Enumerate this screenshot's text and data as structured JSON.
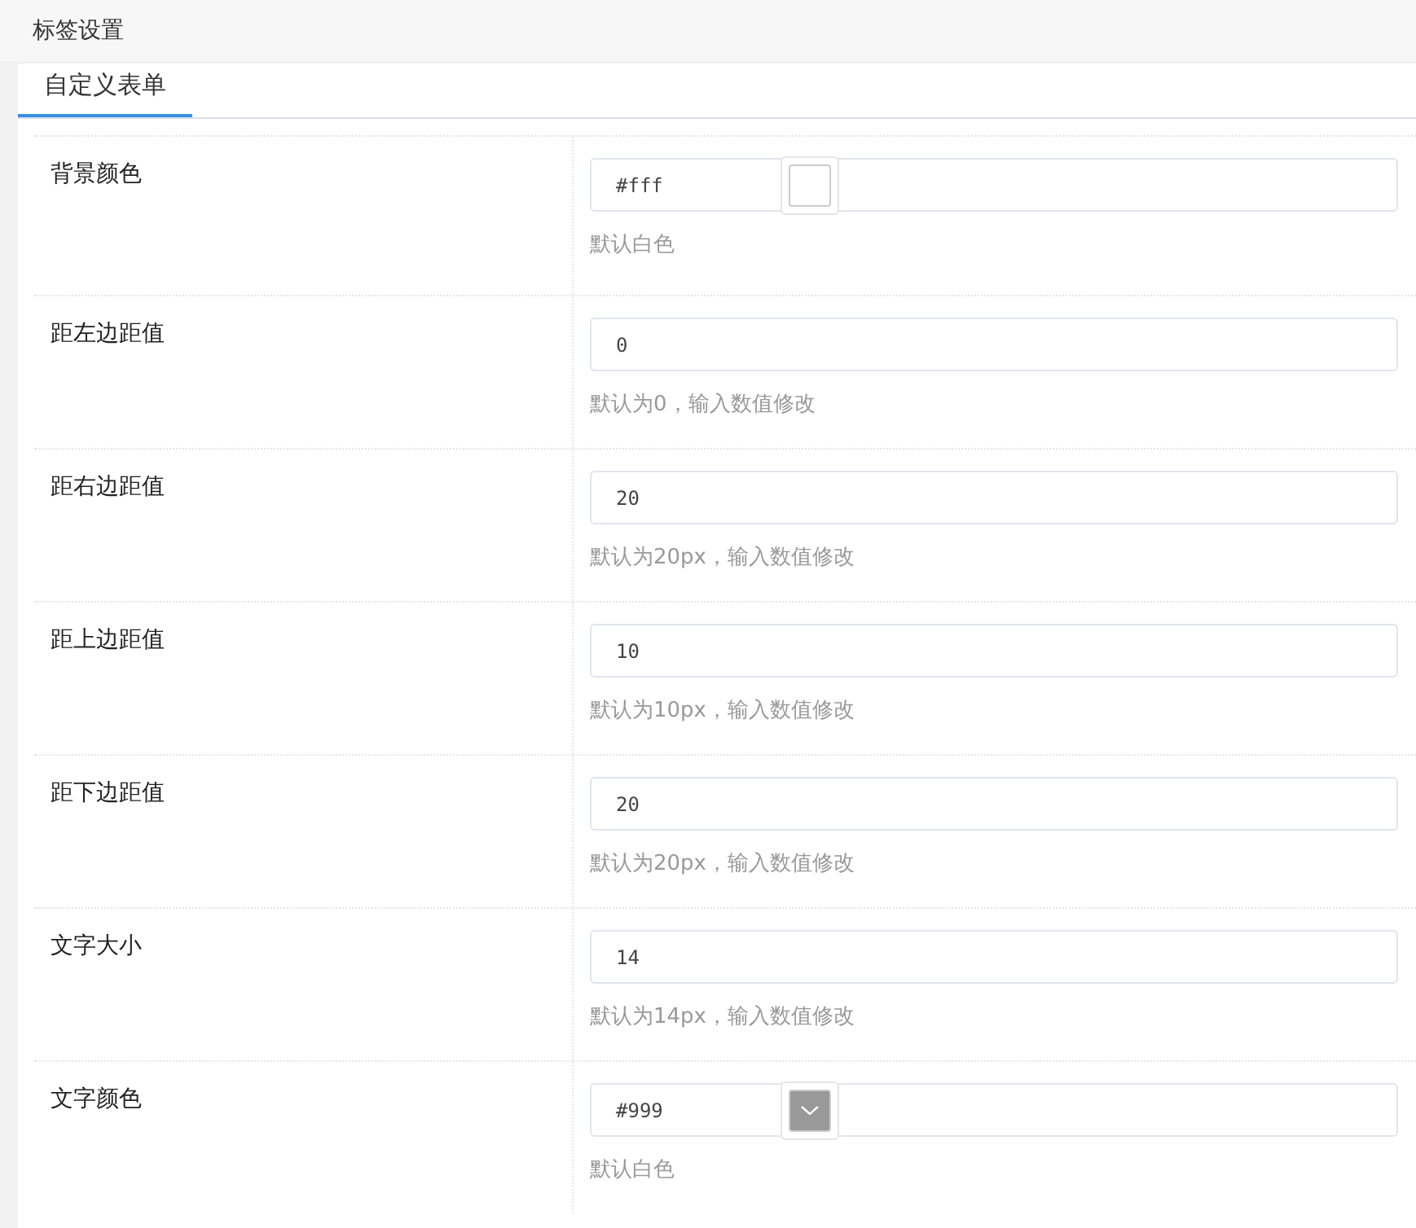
{
  "header": {
    "title": "标签设置"
  },
  "tabs": [
    {
      "label": "自定义表单",
      "selected": true
    }
  ],
  "rows": [
    {
      "kind": "color",
      "label": "背景颜色",
      "value": "#fff",
      "color": "#ffffff",
      "hint": "默认白色"
    },
    {
      "kind": "text",
      "label": "距左边距值",
      "value": "0",
      "hint": "默认为0，输入数值修改"
    },
    {
      "kind": "text",
      "label": "距右边距值",
      "value": "20",
      "hint": "默认为20px，输入数值修改"
    },
    {
      "kind": "text",
      "label": "距上边距值",
      "value": "10",
      "hint": "默认为10px，输入数值修改"
    },
    {
      "kind": "text",
      "label": "距下边距值",
      "value": "20",
      "hint": "默认为20px，输入数值修改"
    },
    {
      "kind": "text",
      "label": "文字大小",
      "value": "14",
      "hint": "默认为14px，输入数值修改"
    },
    {
      "kind": "color",
      "label": "文字颜色",
      "value": "#999",
      "color": "#999999",
      "hint": "默认白色"
    }
  ]
}
